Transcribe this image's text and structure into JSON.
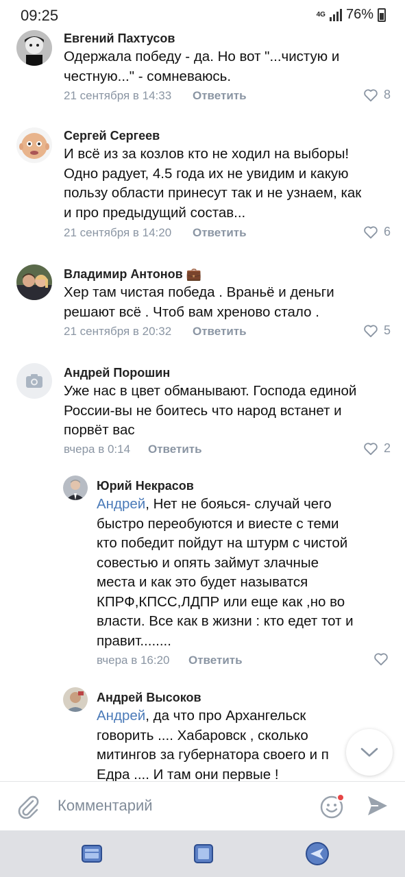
{
  "status_bar": {
    "time": "09:25",
    "network": "4G",
    "battery": "76%"
  },
  "comments": [
    {
      "name": "Евгений Пахтусов",
      "lines": [
        "Одержала победу - да. Но вот \"...чистую и",
        "честную...\" - сомневаюсь."
      ],
      "date": "21 сентября в 14:33",
      "reply": "Ответить",
      "likes": "8"
    },
    {
      "name": "Сергей Сергеев",
      "lines": [
        "И всё из за козлов кто не ходил на выборы!",
        "Одно радует, 4.5 года их не увидим и какую",
        "пользу области принесут так и не узнаем, как",
        "и про предыдущий состав..."
      ],
      "date": "21 сентября в 14:20",
      "reply": "Ответить",
      "likes": "6"
    },
    {
      "name": "Владимир Антонов 💼",
      "lines": [
        "Хер там чистая победа . Враньё и деньги",
        "решают всё . Чтоб вам хреново стало ."
      ],
      "date": "21 сентября в 20:32",
      "reply": "Ответить",
      "likes": "5"
    },
    {
      "name": "Андрей Порошин",
      "lines": [
        "Уже нас в цвет обманывают. Господа единой",
        "России-вы не боитесь что народ встанет и",
        "порвёт вас"
      ],
      "date": "вчера в 0:14",
      "reply": "Ответить",
      "likes": "2"
    }
  ],
  "replies": [
    {
      "name": "Юрий Некрасов",
      "mention": "Андрей",
      "first_line_rest": ", Нет не бояься- случай чего",
      "lines": [
        "быстро переобуются и виесте с теми",
        "кто победит пойдут на штурм с чистой",
        "совестью и опять займут  злачные",
        "места и как это будет называтся",
        "КПРФ,КПСС,ЛДПР или еще как ,но во",
        "власти. Все как в жизни : кто едет тот и",
        "правит........"
      ],
      "date": "вчера в 16:20",
      "reply": "Ответить"
    },
    {
      "name": "Андрей Высоков",
      "mention": "Андрей",
      "first_line_rest": ", да что про Архангельск",
      "lines": [
        "говорить .... Хабаровск , сколько",
        "митингов за губернатора своего и п",
        "Едра .... И там они первые !"
      ]
    }
  ],
  "composer": {
    "placeholder": "Комментарий"
  },
  "colors": {
    "accent": "#4a7ab8",
    "muted": "#8a95a3",
    "navbar": "#dfe0e4"
  }
}
